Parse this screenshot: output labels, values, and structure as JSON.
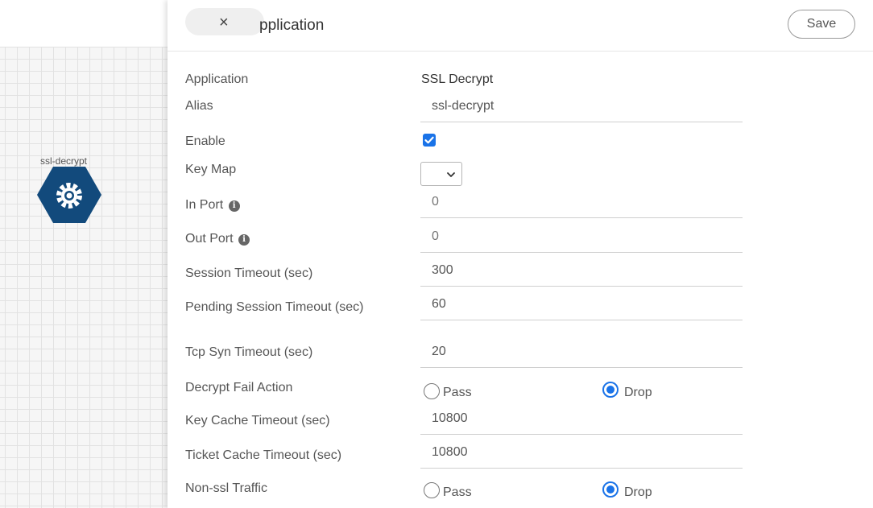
{
  "canvas": {
    "node": {
      "label": "ssl-decrypt",
      "icon": "gear-icon",
      "color": "#124a7c"
    }
  },
  "header": {
    "close_symbol": "×",
    "title": "pplication",
    "save_label": "Save"
  },
  "form": {
    "application": {
      "label": "Application",
      "value": "SSL Decrypt"
    },
    "alias": {
      "label": "Alias",
      "value": "ssl-decrypt"
    },
    "enable": {
      "label": "Enable",
      "checked": true
    },
    "key_map": {
      "label": "Key Map",
      "value": ""
    },
    "in_port": {
      "label": "In Port",
      "value": "0",
      "icon": "info-icon"
    },
    "out_port": {
      "label": "Out Port",
      "value": "0",
      "icon": "info-icon"
    },
    "session_timeout": {
      "label": "Session Timeout (sec)",
      "value": "300"
    },
    "pending_session_timeout": {
      "label": "Pending Session Timeout (sec)",
      "value": "60"
    },
    "tcp_syn_timeout": {
      "label": "Tcp Syn Timeout (sec)",
      "value": "20"
    },
    "decrypt_fail_action": {
      "label": "Decrypt Fail Action",
      "options": [
        "Pass",
        "Drop"
      ],
      "selected": "Drop"
    },
    "key_cache_timeout": {
      "label": "Key Cache Timeout (sec)",
      "value": "10800"
    },
    "ticket_cache_timeout": {
      "label": "Ticket Cache Timeout (sec)",
      "value": "10800"
    },
    "non_ssl_traffic": {
      "label": "Non-ssl Traffic",
      "options": [
        "Pass",
        "Drop"
      ],
      "selected": "Drop"
    }
  },
  "colors": {
    "accent": "#1a73e8",
    "node": "#124a7c"
  }
}
